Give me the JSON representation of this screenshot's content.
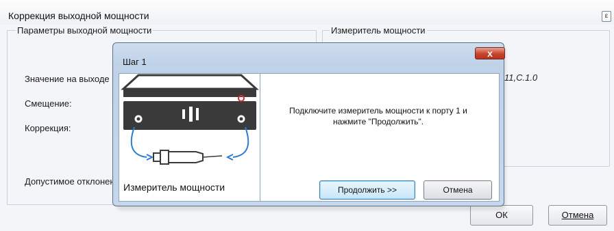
{
  "main_window": {
    "title": "Коррекция выходной мощности",
    "close_glyph": "ε",
    "output_group": {
      "legend": "Параметры выходной мощности",
      "labels": [
        "Значение на выходе",
        "Смещение:",
        "Коррекция:",
        "Допустимое отклонение"
      ]
    },
    "meter_group": {
      "legend": "Измеритель мощности",
      "firmware_value": "11,C.1.0"
    },
    "buttons": {
      "ok": "ОК",
      "cancel": "Отмена"
    }
  },
  "dialog": {
    "title": "Шаг 1",
    "close_glyph": "x",
    "illustration_caption": "Измеритель мощности",
    "message_line1": "Подключите измеритель мощности к порту 1 и",
    "message_line2": "нажмите \"Продолжить\".",
    "buttons": {
      "continue": "Продолжить >>",
      "cancel": "Отмена"
    }
  },
  "colors": {
    "dialog_frame": "#c6d7eb",
    "close_button": "#c8432b",
    "device_body": "#3a3a3a",
    "cable": "#2b7bd0",
    "port_led": "#d0302a"
  }
}
